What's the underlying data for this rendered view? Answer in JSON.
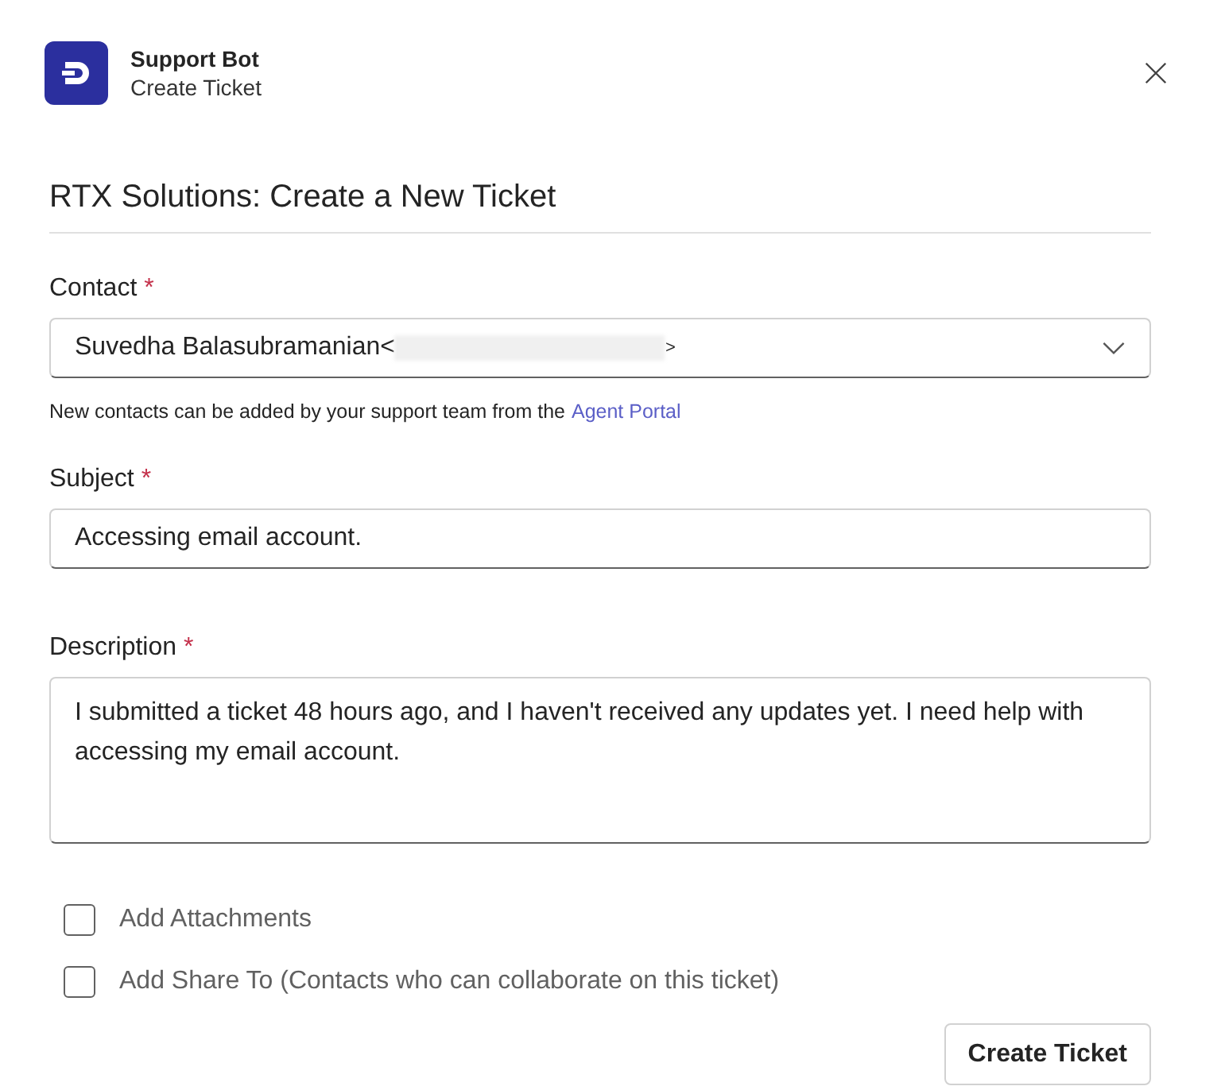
{
  "header": {
    "app_name": "Support Bot",
    "subtitle": "Create Ticket"
  },
  "form_title": "RTX Solutions: Create a New Ticket",
  "contact": {
    "label": "Contact",
    "required_mark": "*",
    "value_parts": [
      "Suvedha Balasubramanian<",
      ">"
    ],
    "redacted": true,
    "help_text": "New contacts can be added by your support team from the",
    "help_link": "Agent Portal"
  },
  "subject": {
    "label": "Subject",
    "required_mark": "*",
    "value": "Accessing email account."
  },
  "description": {
    "label": "Description",
    "required_mark": "*",
    "value": "I submitted a ticket 48 hours ago, and I haven't received any updates yet. I need help with accessing my email account."
  },
  "options": [
    {
      "label": "Add Attachments",
      "checked": false
    },
    {
      "label": "Add Share To (Contacts who can collaborate on this ticket)",
      "checked": false
    }
  ],
  "submit_button": "Create Ticket"
}
